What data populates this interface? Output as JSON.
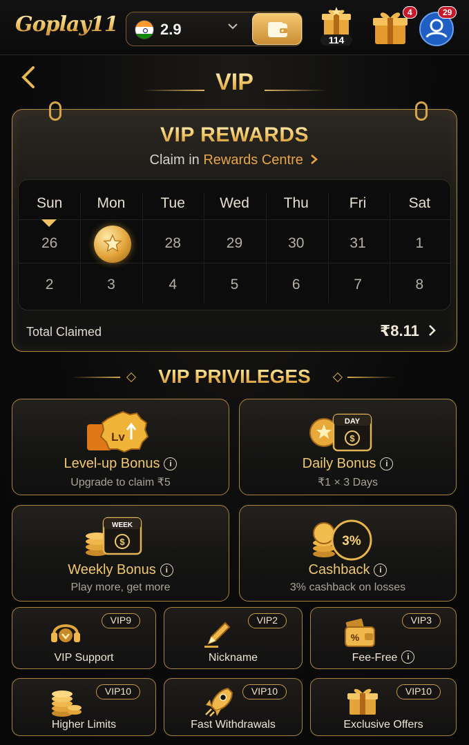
{
  "app": {
    "logo_text": "Goplay11"
  },
  "topbar": {
    "balance": "2.9",
    "gift_count": "114",
    "gift_badge": "4",
    "profile_badge": "29"
  },
  "header": {
    "title": "VIP"
  },
  "rewards": {
    "title": "VIP REWARDS",
    "claim_prefix": "Claim in",
    "claim_link": "Rewards Centre",
    "days": [
      "Sun",
      "Mon",
      "Tue",
      "Wed",
      "Thu",
      "Fri",
      "Sat"
    ],
    "week1": [
      "26",
      "",
      "28",
      "29",
      "30",
      "31",
      "1"
    ],
    "week2": [
      "2",
      "3",
      "4",
      "5",
      "6",
      "7",
      "8"
    ],
    "total_label": "Total Claimed",
    "total_value": "₹8.11"
  },
  "privileges": {
    "title": "VIP PRIVILEGES",
    "big": [
      {
        "title": "Level-up Bonus",
        "sub": "Upgrade to claim ₹5"
      },
      {
        "title": "Daily Bonus",
        "sub": "₹1 × 3 Days"
      },
      {
        "title": "Weekly Bonus",
        "sub": "Play more, get more"
      },
      {
        "title": "Cashback",
        "sub": "3% cashback on losses"
      }
    ],
    "icon_texts": {
      "lv": "Lv",
      "day": "DAY",
      "week": "WEEK",
      "cashback_pct": "3%"
    },
    "small": [
      {
        "badge": "VIP9",
        "label": "VIP Support"
      },
      {
        "badge": "VIP2",
        "label": "Nickname"
      },
      {
        "badge": "VIP3",
        "label": "Fee-Free"
      },
      {
        "badge": "VIP10",
        "label": "Higher Limits"
      },
      {
        "badge": "VIP10",
        "label": "Fast Withdrawals"
      },
      {
        "badge": "VIP10",
        "label": "Exclusive Offers"
      }
    ]
  },
  "colors": {
    "gold": "#f0c872",
    "accent_orange": "#e9a54a",
    "badge_red": "#c8192a",
    "background": "#0b0b0c"
  }
}
